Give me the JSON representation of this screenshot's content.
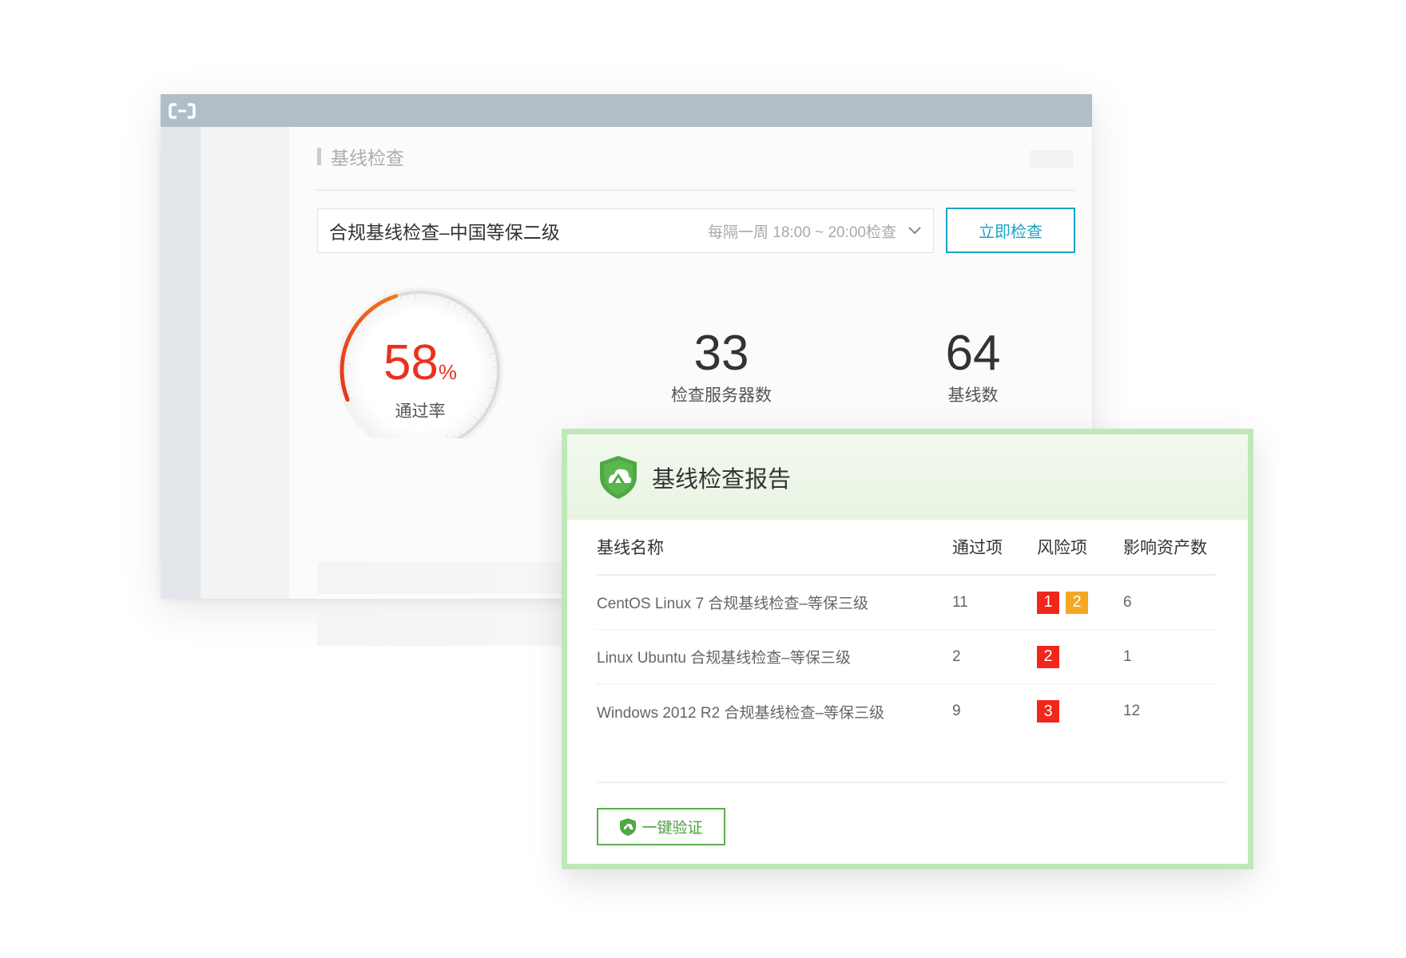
{
  "window": {
    "page_title": "基线检查"
  },
  "selector": {
    "value": "合规基线检查–中国等保二级",
    "schedule": "每隔一周 18:00 ~ 20:00检查"
  },
  "actions": {
    "check_now_label": "立即检查"
  },
  "gauge": {
    "value": 58,
    "value_text": "58",
    "unit": "%",
    "label": "通过率",
    "track_color": "#d9d9d9",
    "fill_gradient": [
      "#e8321e",
      "#ee7d1c"
    ]
  },
  "stats": [
    {
      "value": "33",
      "label": "检查服务器数"
    },
    {
      "value": "64",
      "label": "基线数"
    }
  ],
  "report": {
    "title": "基线检查报告",
    "columns": {
      "name": "基线名称",
      "pass": "通过项",
      "risk": "风险项",
      "assets": "影响资产数"
    },
    "rows": [
      {
        "name": "CentOS Linux 7 合规基线检查–等保三级",
        "pass": "11",
        "risk_high": "1",
        "risk_medium": "2",
        "assets": "6"
      },
      {
        "name": "Linux Ubuntu 合规基线检查–等保三级",
        "pass": "2",
        "risk_high": "2",
        "risk_medium": null,
        "assets": "1"
      },
      {
        "name": "Windows 2012 R2 合规基线检查–等保三级",
        "pass": "9",
        "risk_high": "3",
        "risk_medium": null,
        "assets": "12"
      }
    ],
    "verify_label": "一键验证"
  },
  "colors": {
    "accent_blue": "#1aa3c6",
    "accent_green": "#5dae4e",
    "risk_red": "#f2261a",
    "risk_orange": "#f5a623"
  },
  "icons": {
    "app_logo": "cloud-bracket-logo-icon",
    "dropdown": "chevron-down-icon",
    "report": "shield-logo-icon",
    "verify": "shield-small-icon"
  }
}
